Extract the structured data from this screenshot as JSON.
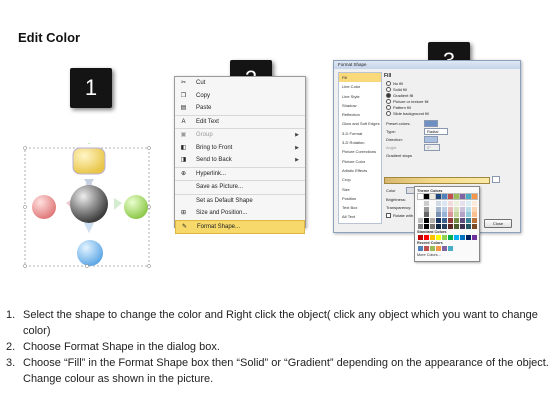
{
  "title": "Edit Color",
  "steps": {
    "one": "1",
    "two": "2",
    "three": "3"
  },
  "context_menu": {
    "items": [
      {
        "label": "Cut",
        "icon": "scissors-icon",
        "glyph": "✂"
      },
      {
        "label": "Copy",
        "icon": "copy-icon",
        "glyph": "❐"
      },
      {
        "label": "Paste",
        "icon": "paste-icon",
        "glyph": "▤"
      },
      {
        "label": "Edit Text",
        "icon": "edit-text-icon",
        "glyph": "A"
      },
      {
        "label": "Group",
        "icon": "group-icon",
        "glyph": "▣"
      },
      {
        "label": "Bring to Front",
        "icon": "bring-front-icon",
        "glyph": "◧"
      },
      {
        "label": "Send to Back",
        "icon": "send-back-icon",
        "glyph": "◨"
      },
      {
        "label": "Hyperlink...",
        "icon": "hyperlink-icon",
        "glyph": "⊕"
      },
      {
        "label": "Save as Picture...",
        "icon": "",
        "glyph": ""
      },
      {
        "label": "Set as Default Shape",
        "icon": "",
        "glyph": ""
      },
      {
        "label": "Size and Position...",
        "icon": "size-position-icon",
        "glyph": "⊞"
      },
      {
        "label": "Format Shape...",
        "icon": "format-shape-icon",
        "glyph": "✎"
      }
    ]
  },
  "dialog": {
    "title": "Format Shape",
    "sidebar": [
      "Fill",
      "Line Color",
      "Line Style",
      "Shadow",
      "Reflection",
      "Glow and Soft Edges",
      "3-D Format",
      "3-D Rotation",
      "Picture Corrections",
      "Picture Color",
      "Artistic Effects",
      "Crop",
      "Size",
      "Position",
      "Text Box",
      "Alt Text"
    ],
    "section": "Fill",
    "fill_options": [
      "No fill",
      "Solid fill",
      "Gradient fill",
      "Picture or texture fill",
      "Pattern fill",
      "Slide background fill"
    ],
    "labels": {
      "preset": "Preset colors:",
      "type": "Type:",
      "type_value": "Radial",
      "direction": "Direction:",
      "angle": "Angle:",
      "angle_value": "0°",
      "stops": "Gradient stops",
      "color": "Color",
      "position": "Position:",
      "position_value": "0%",
      "brightness": "Brightness:",
      "transparency": "Transparency:",
      "rotate": "Rotate with shape",
      "close": "Close"
    }
  },
  "palette": {
    "theme_label": "Theme Colors",
    "standard_label": "Standard Colors",
    "recent_label": "Recent Colors",
    "more_label": "More Colors...",
    "theme_top": [
      "#ffffff",
      "#000000",
      "#eeece1",
      "#1f497d",
      "#4f81bd",
      "#c0504d",
      "#9bbb59",
      "#8064a2",
      "#4bacc6",
      "#f79646"
    ],
    "standard": [
      "#c00000",
      "#ff0000",
      "#ffc000",
      "#ffff00",
      "#92d050",
      "#00b050",
      "#00b0f0",
      "#0070c0",
      "#002060",
      "#7030a0"
    ],
    "recent": [
      "#4f81bd",
      "#c0504d",
      "#9bbb59",
      "#f79646",
      "#8064a2",
      "#4bacc6"
    ]
  },
  "instructions": [
    {
      "num": "1.",
      "text": "Select the shape to change the color and Right click the object( click any object which you want to change color)"
    },
    {
      "num": "2.",
      "text": "Choose Format Shape in the dialog box."
    },
    {
      "num": "3.",
      "text": "Choose “Fill” in the Format Shape box then “Solid” or “Gradient” depending on the appearance of the object. Change colour as shown in the picture."
    }
  ]
}
